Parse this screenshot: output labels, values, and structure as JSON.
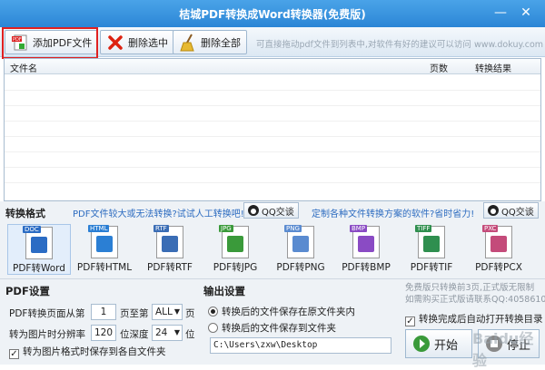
{
  "window": {
    "title": "桔城PDF转换成Word转换器(免费版)",
    "min_label": "—",
    "close_label": "✕"
  },
  "toolbar": {
    "add_label": "添加PDF文件",
    "delete_selected_label": "删除选中",
    "delete_all_label": "删除全部",
    "hint": "可直接拖动pdf文件到列表中,对软件有好的建议可以访问 www.dokuy.com"
  },
  "file_list": {
    "columns": [
      "文件名",
      "页数",
      "转换结果"
    ],
    "rows": []
  },
  "format_section": {
    "title": "转换格式",
    "promo_left": "PDF文件较大或无法转换?试试人工转换吧!",
    "promo_right": "定制各种文件转换方案的软件?省时省力!",
    "qq_label": "QQ交谈",
    "formats": [
      {
        "tag": "DOC",
        "label": "PDF转Word",
        "color": "#2b6cc4",
        "selected": true
      },
      {
        "tag": "HTML",
        "label": "PDF转HTML",
        "color": "#2b7fd4",
        "selected": false
      },
      {
        "tag": "RTF",
        "label": "PDF转RTF",
        "color": "#3a6db5",
        "selected": false
      },
      {
        "tag": "JPG",
        "label": "PDF转JPG",
        "color": "#3a9a3a",
        "selected": false
      },
      {
        "tag": "PNG",
        "label": "PDF转PNG",
        "color": "#5a8bd0",
        "selected": false
      },
      {
        "tag": "BMP",
        "label": "PDF转BMP",
        "color": "#8a4bc4",
        "selected": false
      },
      {
        "tag": "TIFF",
        "label": "PDF转TIF",
        "color": "#2f8f4f",
        "selected": false
      },
      {
        "tag": "PXC",
        "label": "PDF转PCX",
        "color": "#c44b7a",
        "selected": false
      }
    ]
  },
  "pdf_settings": {
    "title": "PDF设置",
    "page_from_label": "PDF转换页面从第",
    "page_from_value": "1",
    "page_to_label": "页至第",
    "page_to_value": "ALL",
    "page_unit": "页",
    "resolution_label": "转为图片时分辨率",
    "resolution_value": "120",
    "depth_label": "位深度",
    "depth_value": "24",
    "depth_unit": "位",
    "save_folder_label": "转为图片格式时保存到各自文件夹",
    "save_folder_checked": true
  },
  "output_settings": {
    "title": "输出设置",
    "option_original": "转换后的文件保存在原文件夹内",
    "option_desktop": "转换后的文件保存到文件夹",
    "path_value": "C:\\Users\\zxw\\Desktop"
  },
  "right_panel": {
    "free_line1": "免费版只转换前3页,正式版无限制",
    "free_line2": "如需购买正式版请联系QQ:405861095",
    "open_dir_label": "转换完成后自动打开转换目录",
    "open_dir_checked": true,
    "start_label": "开始",
    "stop_label": "停止",
    "watermark": "Baidu经验"
  }
}
